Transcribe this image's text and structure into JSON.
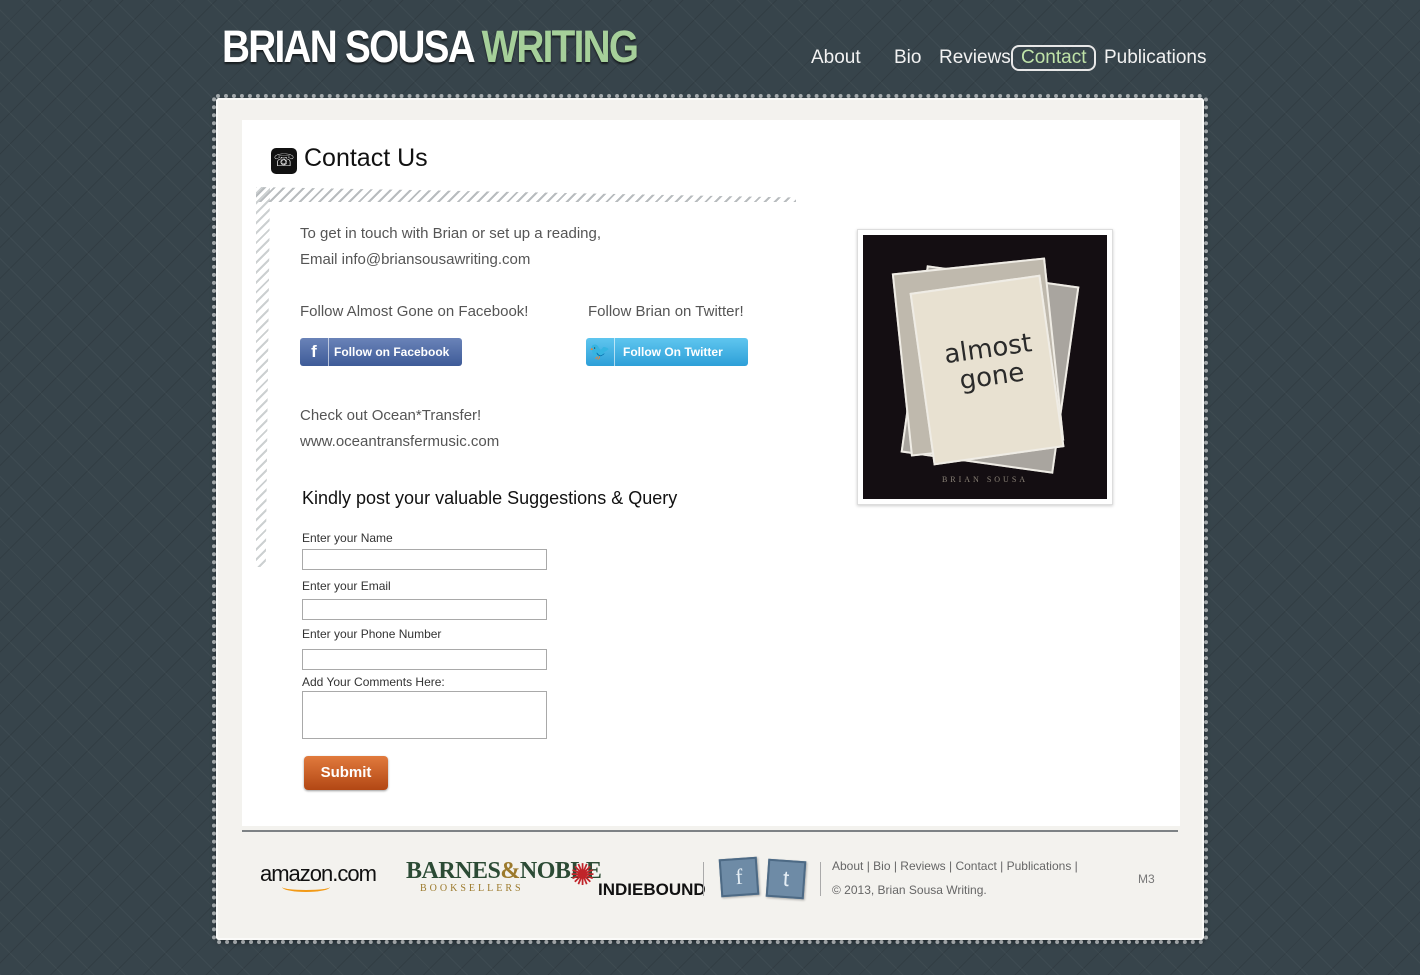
{
  "brand": {
    "name_part1": "BRIAN SOUSA",
    "name_part2": "WRITING"
  },
  "nav": {
    "items": [
      "About",
      "Bio",
      "Reviews",
      "Contact",
      "Publications"
    ],
    "active": "Contact"
  },
  "page": {
    "title": "Contact Us"
  },
  "intro": {
    "line1": "To get in touch with Brian or set up a reading,",
    "line2": "Email info@briansousawriting.com"
  },
  "social": {
    "facebook_heading": "Follow Almost Gone on Facebook!",
    "twitter_heading": "Follow Brian on Twitter!",
    "facebook_button": "Follow on Facebook",
    "twitter_button": "Follow On Twitter"
  },
  "ocean": {
    "line1": "Check out Ocean*Transfer!",
    "line2": "www.oceantransfermusic.com"
  },
  "form": {
    "title": "Kindly post your valuable Suggestions &  Query",
    "name_label": "Enter your Name",
    "email_label": "Enter your Email",
    "phone_label": "Enter your Phone Number",
    "comments_label": "Add Your Comments Here:",
    "submit_label": "Submit"
  },
  "book": {
    "title_line1": "almost",
    "title_line2": "gone",
    "author": "BRIAN SOUSA"
  },
  "footer": {
    "stores": {
      "amazon": "amazon.com",
      "bn_top1": "BARNES",
      "bn_amp": "&",
      "bn_top2": "NOBLE",
      "bn_bottom": "BOOKSELLERS",
      "indie": "INDIEBOUND"
    },
    "links": [
      "About",
      "Bio",
      "Reviews",
      "Contact",
      "Publications"
    ],
    "copyright": "© 2013, Brian Sousa Writing.",
    "code": "M3"
  },
  "colors": {
    "background": "#37444b",
    "brand_accent": "#a6d09a",
    "submit": "#c85a22",
    "facebook": "#4b67a1",
    "twitter": "#39aee3"
  }
}
